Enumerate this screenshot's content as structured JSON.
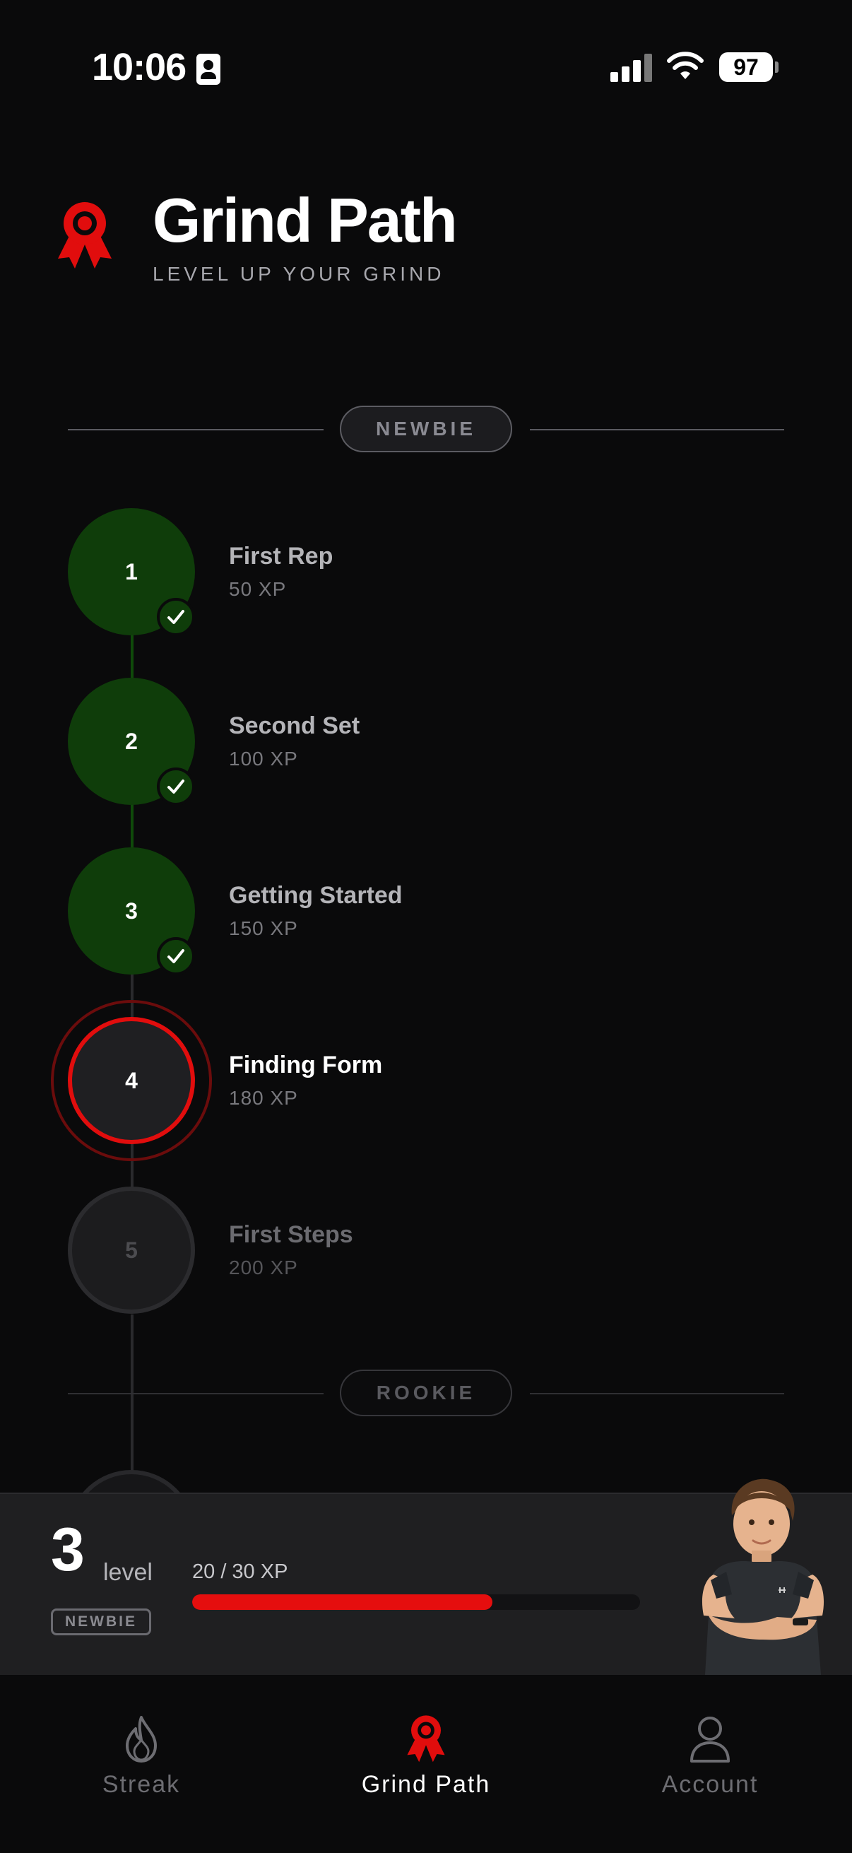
{
  "status_bar": {
    "time": "10:06",
    "battery": "97"
  },
  "header": {
    "title": "Grind Path",
    "subtitle": "LEVEL UP YOUR GRIND"
  },
  "tiers": [
    {
      "label": "NEWBIE"
    },
    {
      "label": "ROOKIE"
    }
  ],
  "steps": [
    {
      "number": "1",
      "title": "First Rep",
      "xp": "50 XP",
      "state": "completed"
    },
    {
      "number": "2",
      "title": "Second Set",
      "xp": "100 XP",
      "state": "completed"
    },
    {
      "number": "3",
      "title": "Getting Started",
      "xp": "150 XP",
      "state": "completed"
    },
    {
      "number": "4",
      "title": "Finding Form",
      "xp": "180 XP",
      "state": "current"
    },
    {
      "number": "5",
      "title": "First Steps",
      "xp": "200 XP",
      "state": "locked"
    }
  ],
  "level_panel": {
    "level": "3",
    "level_label": "level",
    "tier": "NEWBIE",
    "xp_text": "20 / 30 XP",
    "progress": 0.67
  },
  "tab_bar": {
    "tabs": [
      {
        "label": "Streak",
        "icon": "flame-icon",
        "active": false
      },
      {
        "label": "Grind Path",
        "icon": "award-ribbon-icon",
        "active": true
      },
      {
        "label": "Account",
        "icon": "person-icon",
        "active": false
      }
    ]
  },
  "colors": {
    "accent": "#e10d0d",
    "completed": "#0f3d0a",
    "background": "#0a0a0b"
  }
}
